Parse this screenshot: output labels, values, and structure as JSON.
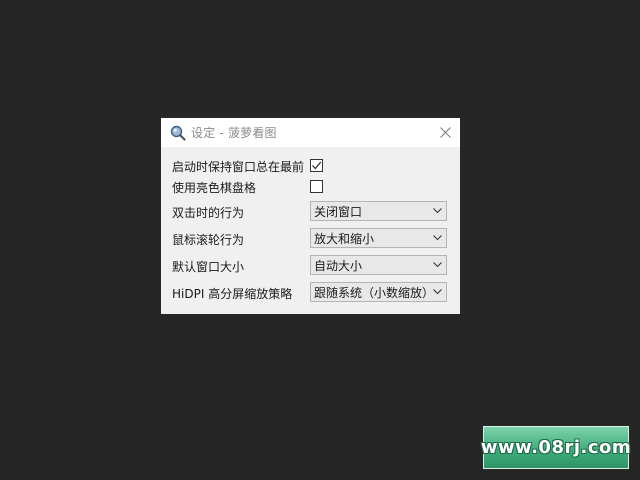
{
  "window": {
    "title": "设定 - 菠萝看图",
    "app_icon": "magnifier-icon",
    "close_icon": "close-icon"
  },
  "settings": {
    "always_on_top": {
      "label": "启动时保持窗口总在最前",
      "checked": true
    },
    "bright_checkerboard": {
      "label": "使用亮色棋盘格",
      "checked": false
    },
    "double_click_action": {
      "label": "双击时的行为",
      "value": "关闭窗口"
    },
    "wheel_action": {
      "label": "鼠标滚轮行为",
      "value": "放大和缩小"
    },
    "default_window_size": {
      "label": "默认窗口大小",
      "value": "自动大小"
    },
    "hidpi_policy": {
      "label": "HiDPI 高分屏缩放策略",
      "value": "跟随系统（小数缩放）"
    }
  },
  "watermark": {
    "text": "www.08rj.com"
  },
  "colors": {
    "desktop_bg": "#262626",
    "dialog_bg": "#f0f0f0",
    "titlebar_bg": "#ffffff",
    "watermark_green": "#3fae7c"
  }
}
